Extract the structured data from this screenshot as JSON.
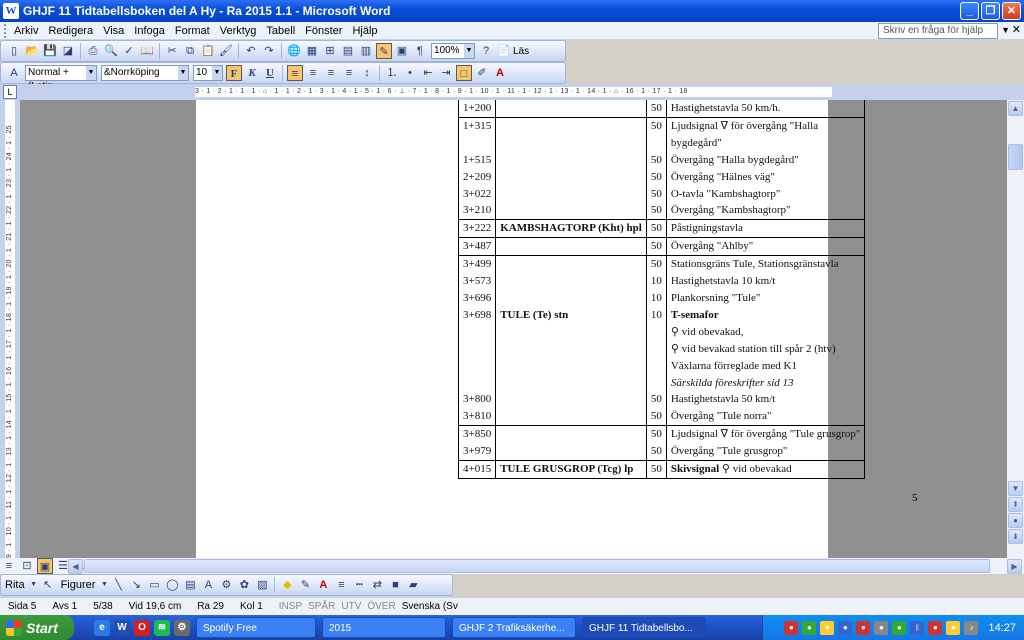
{
  "window": {
    "title": "GHJF 11 Tidtabellsboken del A Hy - Ra 2015 1.1 - Microsoft Word",
    "app_icon_glyph": "W"
  },
  "menubar": {
    "items": [
      "Arkiv",
      "Redigera",
      "Visa",
      "Infoga",
      "Format",
      "Verktyg",
      "Tabell",
      "Fönster",
      "Hjälp"
    ],
    "help_placeholder": "Skriv en fråga för hjälp"
  },
  "standard_toolbar": {
    "zoom": "100%",
    "read_label": "Läs"
  },
  "format_toolbar": {
    "style": "Normal + (Latin",
    "font": "&Norrköping",
    "size": "10"
  },
  "ruler": {
    "horizontal_ticks": "3 · 1 · 2 · 1 · 1 · 1 · ⌂ · 1 · 1 · 2 · 1 · 3 · 1 · 4 · 1 · 5 · 1 · 6 · ⊥ · 7 · 1 · 8 · 1 · 9 · 1 · 10 · 1 · 11 · 1 · 12 · 1 · 13 · 1 · 14 · 1 · ⌂ · 16 · 1 · 17 · 1 · 18",
    "vertical_ticks": "9 · 1 · 10 · 1 · 11 · 1 · 12 · 1 · 13 · 1 · 14 · 1 · 15 · 1 · 16 · 1 · 17 · 1 · 18 · 1 · 19 · 1 · 20 · 1 · 21 · 1 · 22 · 1 · 23 · 1 · 24 · 1 · 25"
  },
  "document": {
    "rows": [
      {
        "km": "1+200",
        "place": "",
        "speed": "50",
        "note": "Hastighetstavla 50 km/h.",
        "sec": false
      },
      {
        "km": "1+315",
        "place": "",
        "speed": "50",
        "note": "Ljudsignal ∇ för övergång \"Halla",
        "sec": true
      },
      {
        "km": "",
        "place": "",
        "speed": "",
        "note": "bygdegård\"",
        "sec": false
      },
      {
        "km": "1+515",
        "place": "",
        "speed": "50",
        "note": "Övergång \"Halla bygdegård\"",
        "sec": false
      },
      {
        "km": "2+209",
        "place": "",
        "speed": "50",
        "note": "Övergång \"Hälnes väg\"",
        "sec": false
      },
      {
        "km": "3+022",
        "place": "",
        "speed": "50",
        "note": "O-tavla \"Kambshagtorp\"",
        "sec": false
      },
      {
        "km": "3+210",
        "place": "",
        "speed": "50",
        "note": "Övergång \"Kambshagtorp\"",
        "sec": false
      },
      {
        "km": "3+222",
        "place": "KAMBSHAGTORP (Kht) hpl",
        "speed": "50",
        "note": "Påstigningstavla",
        "sec": true
      },
      {
        "km": "3+487",
        "place": "",
        "speed": "50",
        "note": "Övergång \"Ahlby\"",
        "sec": true
      },
      {
        "km": "3+499",
        "place": "",
        "speed": "50",
        "note": "Stationsgräns Tule, Stationsgränstavla",
        "sec": true
      },
      {
        "km": "3+573",
        "place": "",
        "speed": "10",
        "note": "Hastighetstavla 10 km/t",
        "sec": false
      },
      {
        "km": "3+696",
        "place": "",
        "speed": "10",
        "note": "Plankorsning \"Tule\"",
        "sec": false
      },
      {
        "km": "3+698",
        "place": "TULE (Te) stn",
        "speed": "10",
        "note": "T-semafor",
        "sec": false,
        "bold_note": true
      },
      {
        "km": "",
        "place": "",
        "speed": "",
        "note": "⚲ vid obevakad,",
        "sec": false
      },
      {
        "km": "",
        "place": "",
        "speed": "",
        "note": "⚲  vid bevakad station till spår 2 (htv)",
        "sec": false
      },
      {
        "km": "",
        "place": "",
        "speed": "",
        "note": "Växlarna förreglade med K1",
        "sec": false
      },
      {
        "km": "",
        "place": "",
        "speed": "",
        "note": "Särskilda föreskrifter sid 13",
        "sec": false,
        "ital_note": true
      },
      {
        "km": "3+800",
        "place": "",
        "speed": "50",
        "note": "Hastighetstavla 50 km/t",
        "sec": false
      },
      {
        "km": "3+810",
        "place": "",
        "speed": "50",
        "note": "Övergång \"Tule norra\"",
        "sec": false
      },
      {
        "km": "3+850",
        "place": "",
        "speed": "50",
        "note": "Ljudsignal ∇ för övergång \"Tule grusgrop\"",
        "sec": true
      },
      {
        "km": "3+979",
        "place": "",
        "speed": "50",
        "note": "Övergång \"Tule grusgrop\"",
        "sec": false
      },
      {
        "km": "4+015",
        "place": "TULE GRUSGROP (Tcg) lp",
        "speed": "50",
        "note": "Skivsignal ⚲ vid obevakad",
        "sec": true,
        "end": true,
        "note_prefix_bold": "Skivsignal"
      }
    ],
    "page_number": "5"
  },
  "drawing_toolbar": {
    "draw_label": "Rita",
    "shapes_label": "Figurer"
  },
  "statusbar": {
    "page": "Sida  5",
    "section": "Avs  1",
    "pages": "5/38",
    "at": "Vid  19,6 cm",
    "line": "Ra  29",
    "col": "Kol  1",
    "rec": "INSP",
    "trk": "SPÅR",
    "ext": "UTV",
    "ovr": "ÖVER",
    "lang": "Svenska (Sv"
  },
  "taskbar": {
    "start_label": "Start",
    "tasks": [
      "Spotify Free",
      "2015",
      "GHJF 2 Trafiksäkerhe...",
      "GHJF 11 Tidtabellsbo..."
    ],
    "clock": "14:27"
  }
}
